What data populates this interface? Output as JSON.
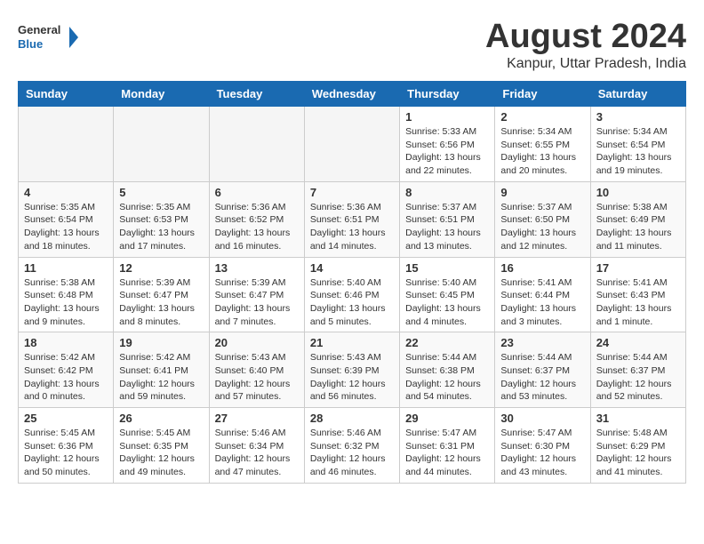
{
  "header": {
    "logo_general": "General",
    "logo_blue": "Blue",
    "month_title": "August 2024",
    "location": "Kanpur, Uttar Pradesh, India"
  },
  "days_of_week": [
    "Sunday",
    "Monday",
    "Tuesday",
    "Wednesday",
    "Thursday",
    "Friday",
    "Saturday"
  ],
  "weeks": [
    [
      {
        "day": "",
        "empty": true
      },
      {
        "day": "",
        "empty": true
      },
      {
        "day": "",
        "empty": true
      },
      {
        "day": "",
        "empty": true
      },
      {
        "day": "1",
        "sunrise": "5:33 AM",
        "sunset": "6:56 PM",
        "daylight": "13 hours and 22 minutes."
      },
      {
        "day": "2",
        "sunrise": "5:34 AM",
        "sunset": "6:55 PM",
        "daylight": "13 hours and 20 minutes."
      },
      {
        "day": "3",
        "sunrise": "5:34 AM",
        "sunset": "6:54 PM",
        "daylight": "13 hours and 19 minutes."
      }
    ],
    [
      {
        "day": "4",
        "sunrise": "5:35 AM",
        "sunset": "6:54 PM",
        "daylight": "13 hours and 18 minutes."
      },
      {
        "day": "5",
        "sunrise": "5:35 AM",
        "sunset": "6:53 PM",
        "daylight": "13 hours and 17 minutes."
      },
      {
        "day": "6",
        "sunrise": "5:36 AM",
        "sunset": "6:52 PM",
        "daylight": "13 hours and 16 minutes."
      },
      {
        "day": "7",
        "sunrise": "5:36 AM",
        "sunset": "6:51 PM",
        "daylight": "13 hours and 14 minutes."
      },
      {
        "day": "8",
        "sunrise": "5:37 AM",
        "sunset": "6:51 PM",
        "daylight": "13 hours and 13 minutes."
      },
      {
        "day": "9",
        "sunrise": "5:37 AM",
        "sunset": "6:50 PM",
        "daylight": "13 hours and 12 minutes."
      },
      {
        "day": "10",
        "sunrise": "5:38 AM",
        "sunset": "6:49 PM",
        "daylight": "13 hours and 11 minutes."
      }
    ],
    [
      {
        "day": "11",
        "sunrise": "5:38 AM",
        "sunset": "6:48 PM",
        "daylight": "13 hours and 9 minutes."
      },
      {
        "day": "12",
        "sunrise": "5:39 AM",
        "sunset": "6:47 PM",
        "daylight": "13 hours and 8 minutes."
      },
      {
        "day": "13",
        "sunrise": "5:39 AM",
        "sunset": "6:47 PM",
        "daylight": "13 hours and 7 minutes."
      },
      {
        "day": "14",
        "sunrise": "5:40 AM",
        "sunset": "6:46 PM",
        "daylight": "13 hours and 5 minutes."
      },
      {
        "day": "15",
        "sunrise": "5:40 AM",
        "sunset": "6:45 PM",
        "daylight": "13 hours and 4 minutes."
      },
      {
        "day": "16",
        "sunrise": "5:41 AM",
        "sunset": "6:44 PM",
        "daylight": "13 hours and 3 minutes."
      },
      {
        "day": "17",
        "sunrise": "5:41 AM",
        "sunset": "6:43 PM",
        "daylight": "13 hours and 1 minute."
      }
    ],
    [
      {
        "day": "18",
        "sunrise": "5:42 AM",
        "sunset": "6:42 PM",
        "daylight": "13 hours and 0 minutes."
      },
      {
        "day": "19",
        "sunrise": "5:42 AM",
        "sunset": "6:41 PM",
        "daylight": "12 hours and 59 minutes."
      },
      {
        "day": "20",
        "sunrise": "5:43 AM",
        "sunset": "6:40 PM",
        "daylight": "12 hours and 57 minutes."
      },
      {
        "day": "21",
        "sunrise": "5:43 AM",
        "sunset": "6:39 PM",
        "daylight": "12 hours and 56 minutes."
      },
      {
        "day": "22",
        "sunrise": "5:44 AM",
        "sunset": "6:38 PM",
        "daylight": "12 hours and 54 minutes."
      },
      {
        "day": "23",
        "sunrise": "5:44 AM",
        "sunset": "6:37 PM",
        "daylight": "12 hours and 53 minutes."
      },
      {
        "day": "24",
        "sunrise": "5:44 AM",
        "sunset": "6:37 PM",
        "daylight": "12 hours and 52 minutes."
      }
    ],
    [
      {
        "day": "25",
        "sunrise": "5:45 AM",
        "sunset": "6:36 PM",
        "daylight": "12 hours and 50 minutes."
      },
      {
        "day": "26",
        "sunrise": "5:45 AM",
        "sunset": "6:35 PM",
        "daylight": "12 hours and 49 minutes."
      },
      {
        "day": "27",
        "sunrise": "5:46 AM",
        "sunset": "6:34 PM",
        "daylight": "12 hours and 47 minutes."
      },
      {
        "day": "28",
        "sunrise": "5:46 AM",
        "sunset": "6:32 PM",
        "daylight": "12 hours and 46 minutes."
      },
      {
        "day": "29",
        "sunrise": "5:47 AM",
        "sunset": "6:31 PM",
        "daylight": "12 hours and 44 minutes."
      },
      {
        "day": "30",
        "sunrise": "5:47 AM",
        "sunset": "6:30 PM",
        "daylight": "12 hours and 43 minutes."
      },
      {
        "day": "31",
        "sunrise": "5:48 AM",
        "sunset": "6:29 PM",
        "daylight": "12 hours and 41 minutes."
      }
    ]
  ]
}
